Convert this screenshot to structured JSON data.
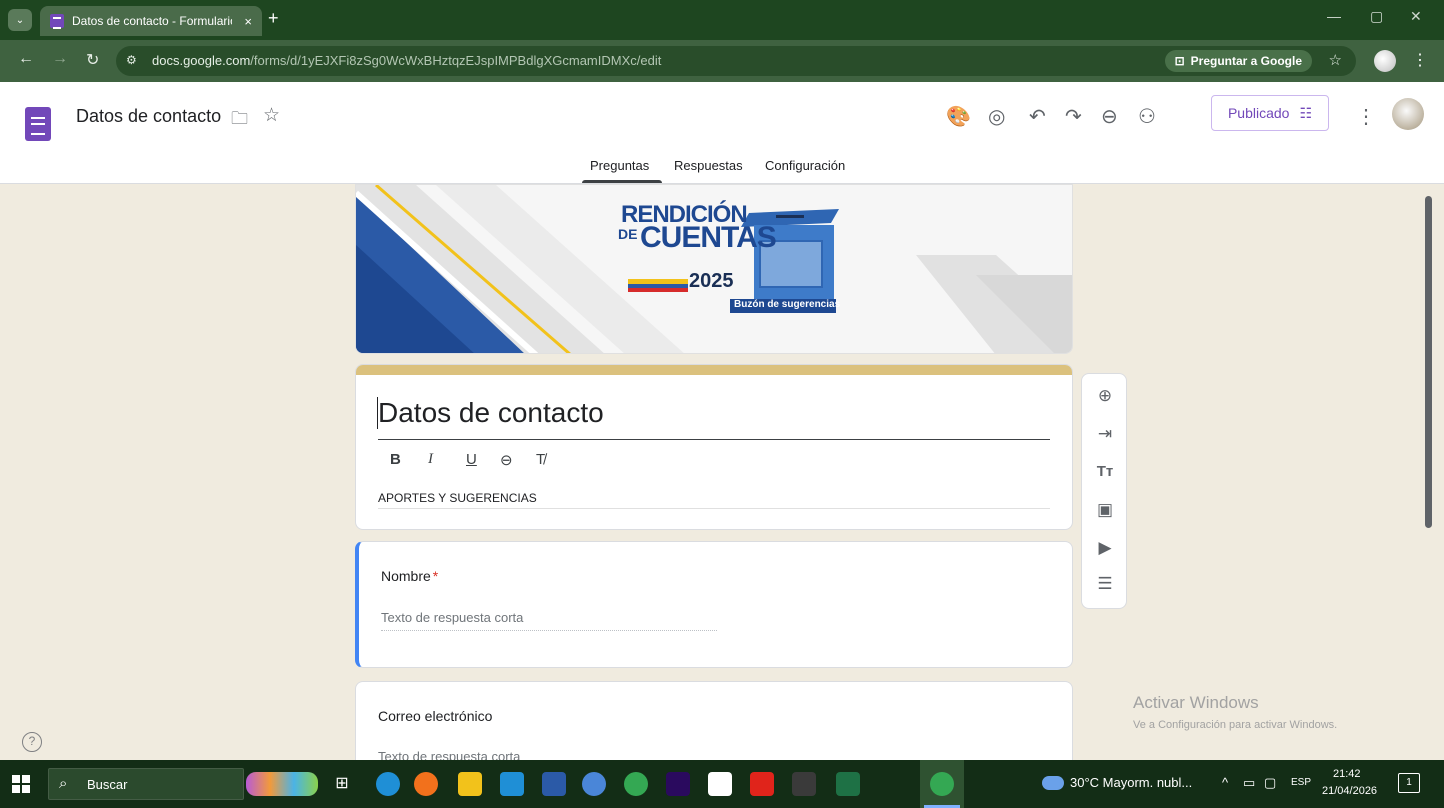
{
  "browser": {
    "tab_title": "Datos de contacto - Formulario",
    "tab_close": "×",
    "new_tab": "+",
    "url_host": "docs.google.com",
    "url_path": "/forms/d/1yEJXFi8zSg0WcWxBHztqzEJspIMPBdlgXGcmamIDMXc/edit",
    "ask_google": "Preguntar a Google",
    "win_min": "—",
    "win_max": "▢",
    "win_close": "✕"
  },
  "forms": {
    "doc_title": "Datos de contacto",
    "publish_label": "Publicado",
    "tabs": [
      "Preguntas",
      "Respuestas",
      "Configuración"
    ],
    "active_tab": "Preguntas"
  },
  "banner": {
    "line1": "RENDICIÓN",
    "line2_prefix": "DE",
    "line2": "CUENTAS",
    "year": "2025",
    "tagline": "Buzón de sugerencias"
  },
  "form": {
    "title": "Datos de contacto",
    "description": "APORTES Y SUGERENCIAS",
    "format_buttons": [
      "B",
      "I",
      "U",
      "⊖",
      "T̸"
    ],
    "questions": [
      {
        "title": "Nombre",
        "required_mark": "*",
        "placeholder": "Texto de respuesta corta"
      },
      {
        "title": "Correo electrónico",
        "required_mark": "",
        "placeholder": "Texto de respuesta corta"
      }
    ]
  },
  "watermark": {
    "line1": "Activar Windows",
    "line2": "Ve a Configuración para activar Windows."
  },
  "taskbar": {
    "search_placeholder": "Buscar",
    "weather": "30°C  Mayorm. nubl...",
    "language": "ESP",
    "time": "21:42",
    "date": "21/04/2026",
    "notification_count": "1"
  },
  "colors": {
    "chrome_dark": "#1e4620",
    "chrome_mid": "#3f6240",
    "forms_purple": "#7248b9",
    "page_bg": "#f0ebdf",
    "header_accent": "#dbc17d",
    "active_question": "#4285f4"
  }
}
